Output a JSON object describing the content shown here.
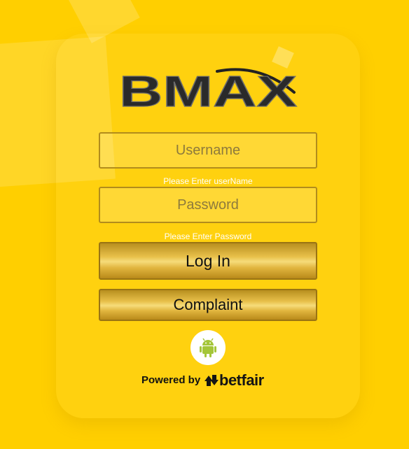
{
  "brand": {
    "logo_text": "BMAX"
  },
  "login_form": {
    "username_placeholder": "Username",
    "username_value": "",
    "username_hint": "Please Enter userName",
    "password_placeholder": "Password",
    "password_value": "",
    "password_hint": "Please Enter Password",
    "login_label": "Log In",
    "complaint_label": "Complaint"
  },
  "footer": {
    "android_icon": "android-icon",
    "powered_by_label": "Powered by",
    "provider_name": "betfair"
  },
  "colors": {
    "background": "#ffcf00",
    "button_gold": "#e8c04a",
    "field_border": "#b28c1c",
    "android_green": "#a4c639",
    "hint_text": "#ffffff"
  }
}
